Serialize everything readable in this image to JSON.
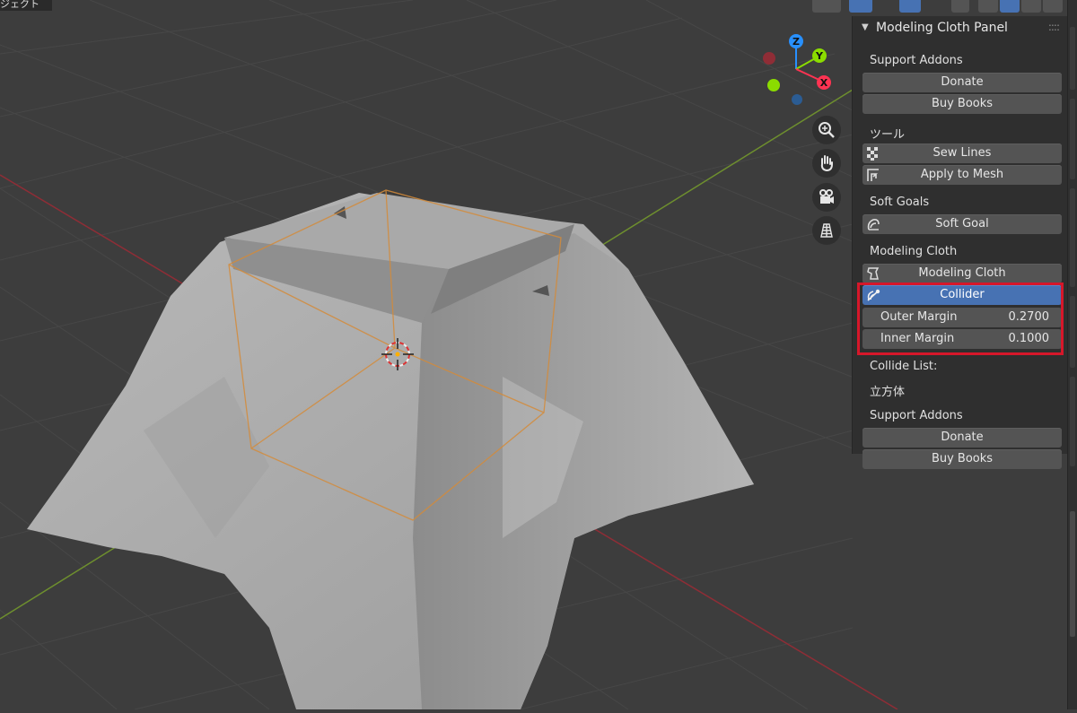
{
  "viewport": {
    "top_left_label": "ジェクト"
  },
  "navigation_gizmo": {
    "z_label": "Z",
    "y_label": "Y",
    "x_label": "X"
  },
  "panel": {
    "title": "Modeling Cloth Panel",
    "support_addons_1": {
      "heading": "Support Addons",
      "donate_label": "Donate",
      "buy_books_label": "Buy Books"
    },
    "tools": {
      "heading": "ツール",
      "sew_lines_label": "Sew Lines",
      "apply_to_mesh_label": "Apply to Mesh"
    },
    "soft_goals": {
      "heading": "Soft Goals",
      "soft_goal_label": "Soft Goal"
    },
    "modeling_cloth": {
      "heading": "Modeling Cloth",
      "modeling_cloth_label": "Modeling Cloth",
      "collider_label": "Collider",
      "outer_margin_label": "Outer Margin",
      "outer_margin_value": "0.2700",
      "inner_margin_label": "Inner Margin",
      "inner_margin_value": "0.1000"
    },
    "collide_list": {
      "heading": "Collide List:",
      "item": "立方体"
    },
    "support_addons_2": {
      "heading": "Support Addons",
      "donate_label": "Donate",
      "buy_books_label": "Buy Books"
    }
  },
  "colors": {
    "viewport_bg": "#3d3d3d",
    "panel_bg": "#2f2f2f",
    "button_bg": "#545454",
    "active_button": "#4772b3",
    "highlight_box": "#d6172a",
    "x_axis": "#ff3352",
    "y_axis": "#8bdc00",
    "z_axis": "#2890ff"
  }
}
